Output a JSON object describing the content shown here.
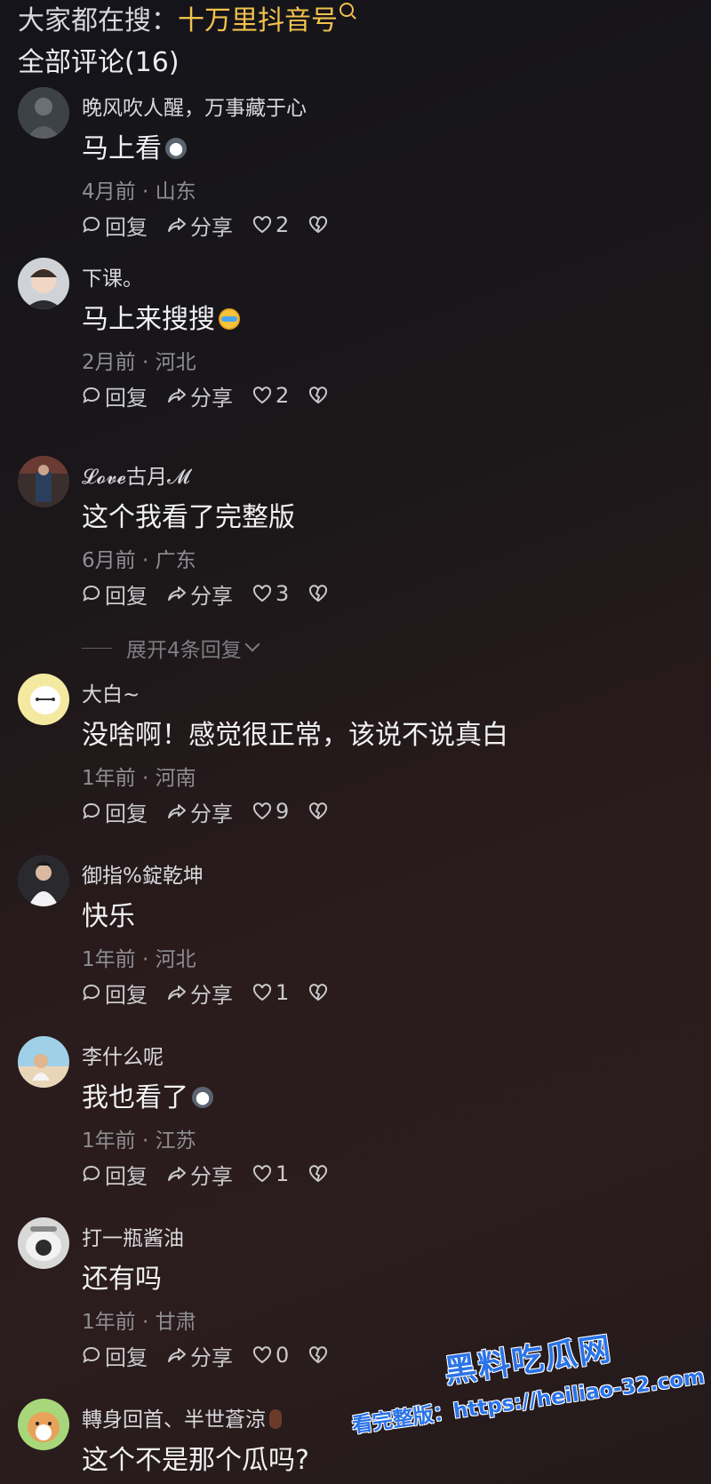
{
  "search": {
    "prefix": "大家都在搜：",
    "keyword": "十万里抖音号"
  },
  "comments_title": "全部评论(16)",
  "actions": {
    "reply": "回复",
    "share": "分享"
  },
  "comments": [
    {
      "user": "晚风吹人醒，万事藏于心",
      "text": "马上看",
      "emoji": "dog-emoji",
      "meta": "4月前 · 山东",
      "likes": "2"
    },
    {
      "user": "下课。",
      "text": "马上来搜搜",
      "emoji": "laugh-cry-emoji",
      "meta": "2月前 · 河北",
      "likes": "2"
    },
    {
      "user": "𝓛𝓸𝓿𝓮古月𝓜",
      "text": "这个我看了完整版",
      "meta": "6月前 · 广东",
      "likes": "3"
    },
    {
      "user": "大白~",
      "text": "没啥啊！感觉很正常，该说不说真白",
      "meta": "1年前 · 河南",
      "likes": "9"
    },
    {
      "user": "御指%錠乾坤",
      "text": "快乐",
      "meta": "1年前 · 河北",
      "likes": "1"
    },
    {
      "user": "李什么呢",
      "text": "我也看了",
      "emoji": "dog-emoji",
      "meta": "1年前 · 江苏",
      "likes": "1"
    },
    {
      "user": "打一瓶酱油",
      "text": "还有吗",
      "meta": "1年前 · 甘肃",
      "likes": "0"
    },
    {
      "user": "轉身回首、半世蒼涼",
      "text": "这个不是那个瓜吗?",
      "meta": "",
      "likes": ""
    }
  ],
  "expand_replies": "展开4条回复",
  "watermark": {
    "logo": "黑料吃瓜网",
    "url": "看完整版：https://heiliao-32.com"
  },
  "colors": {
    "keyword": "#f2c14e",
    "watermark": "#2a73e8",
    "meta": "#8e8e94"
  }
}
